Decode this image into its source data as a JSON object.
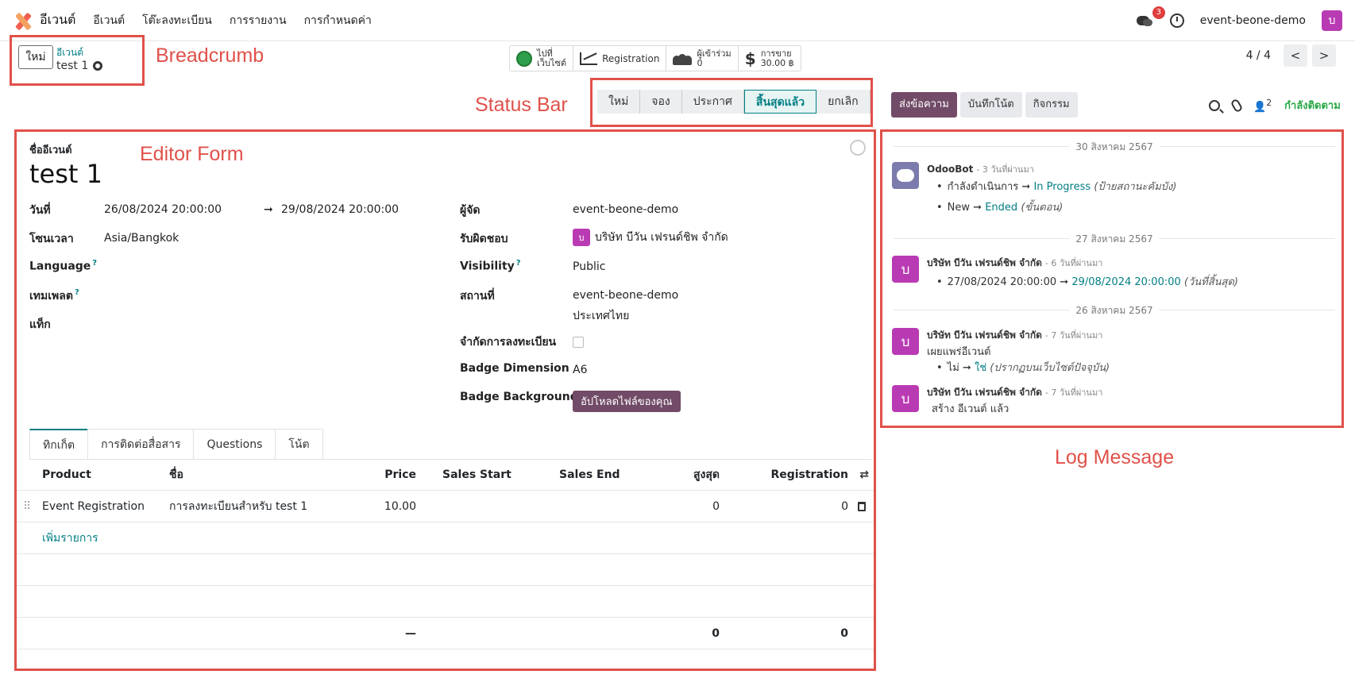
{
  "topnav": {
    "app_name": "อีเวนต์",
    "menu": [
      "อีเวนต์",
      "โต๊ะลงทะเบียน",
      "การรายงาน",
      "การกำหนดค่า"
    ],
    "chat_count": "3",
    "db_name": "event-beone-demo",
    "user_initial": "บ"
  },
  "breadcrumb": {
    "new_label": "ใหม่",
    "parent": "อีเวนต์",
    "current": "test 1"
  },
  "annotations": {
    "breadcrumb": "Breadcrumb",
    "status_bar": "Status Bar",
    "editor_form": "Editor Form",
    "log_message": "Log Message"
  },
  "smart_buttons": {
    "website_l1": "ไปที่",
    "website_l2": "เว็บไซต์",
    "registration": "Registration",
    "attendees_label": "ผู้เข้าร่วม",
    "attendees_value": "0",
    "sales_label": "การขาย",
    "sales_value": "30.00 ฿"
  },
  "pager": {
    "text": "4 / 4",
    "prev": "<",
    "next": ">"
  },
  "statusbar": {
    "stages": [
      "ใหม่",
      "จอง",
      "ประกาศ",
      "สิ้นสุดแล้ว",
      "ยกเลิก"
    ],
    "active_index": 3
  },
  "chatter_actions": {
    "send": "ส่งข้อความ",
    "note": "บันทึกโน้ต",
    "activity": "กิจกรรม",
    "followers": "2",
    "following": "กำลังติดตาม"
  },
  "form": {
    "name_label": "ชื่ออีเวนต์",
    "name": "test 1",
    "date_label": "วันที่",
    "date_begin": "26/08/2024 20:00:00",
    "date_arrow": "➞",
    "date_end": "29/08/2024 20:00:00",
    "tz_label": "โซนเวลา",
    "tz": "Asia/Bangkok",
    "language_label": "Language",
    "template_label": "เทมเพลต",
    "tags_label": "แท็ก",
    "help_mark": "?",
    "organizer_label": "ผู้จัด",
    "organizer": "event-beone-demo",
    "responsible_label": "รับผิดชอบ",
    "responsible": "บริษัท บีวัน เฟรนด์ชิพ จำกัด",
    "responsible_initial": "บ",
    "visibility_label": "Visibility",
    "visibility": "Public",
    "venue_label": "สถานที่",
    "venue_line1": "event-beone-demo",
    "venue_line2": "ประเทศไทย",
    "limit_label": "จำกัดการลงทะเบียน",
    "limit_checked": false,
    "badge_dim_label": "Badge Dimension",
    "badge_dim": "A6",
    "badge_bg_label": "Badge Background",
    "badge_bg_button": "อัปโหลดไฟล์ของคุณ"
  },
  "tabs": [
    "ทิกเก็ต",
    "การติดต่อสื่อสาร",
    "Questions",
    "โน้ต"
  ],
  "ticket_table": {
    "headers": {
      "product": "Product",
      "name": "ชื่อ",
      "price": "Price",
      "sales_start": "Sales Start",
      "sales_end": "Sales End",
      "max": "สูงสุด",
      "registration": "Registration"
    },
    "rows": [
      {
        "product": "Event Registration",
        "name": "การลงทะเบียนสำหรับ test 1",
        "price": "10.00",
        "sales_start": "",
        "sales_end": "",
        "max": "0",
        "registration": "0"
      }
    ],
    "add_line": "เพิ่มรายการ",
    "footer": {
      "price": "—",
      "max": "0",
      "registration": "0"
    }
  },
  "chatter": {
    "messages": [
      {
        "date": "30 สิงหาคม 2567",
        "author": "OdooBot",
        "time": "- 3 วันที่ผ่านมา",
        "l1_from": "กำลังดำเนินการ",
        "l1_arrow": "➞",
        "l1_to": "In Progress",
        "l1_note": "(ป้ายสถานะคัมบัง)",
        "l2_from": "New",
        "l2_arrow": "➞",
        "l2_to": "Ended",
        "l2_note": "(ขั้นตอน)"
      },
      {
        "date": "27 สิงหาคม 2567",
        "author": "บริษัท บีวัน เฟรนด์ชิพ จำกัด",
        "time": "- 6 วันที่ผ่านมา",
        "l1_from": "27/08/2024 20:00:00",
        "l1_arrow": "➞",
        "l1_to": "29/08/2024 20:00:00",
        "l1_note": "(วันที่สิ้นสุด)"
      },
      {
        "date": "26 สิงหาคม 2567",
        "author": "บริษัท บีวัน เฟรนด์ชิพ จำกัด",
        "time": "- 7 วันที่ผ่านมา",
        "body": "เผยแพร่อีเวนต์",
        "l1_from": "ไม่",
        "l1_arrow": "➞",
        "l1_to": "ใช่",
        "l1_note": "(ปรากฏบนเว็บไซต์ปัจจุบัน)"
      },
      {
        "author": "บริษัท บีวัน เฟรนด์ชิพ จำกัด",
        "time": "- 7 วันที่ผ่านมา",
        "body": "สร้าง อีเวนต์ แล้ว"
      }
    ],
    "bullet": "•",
    "avatar_initial": "บ"
  }
}
